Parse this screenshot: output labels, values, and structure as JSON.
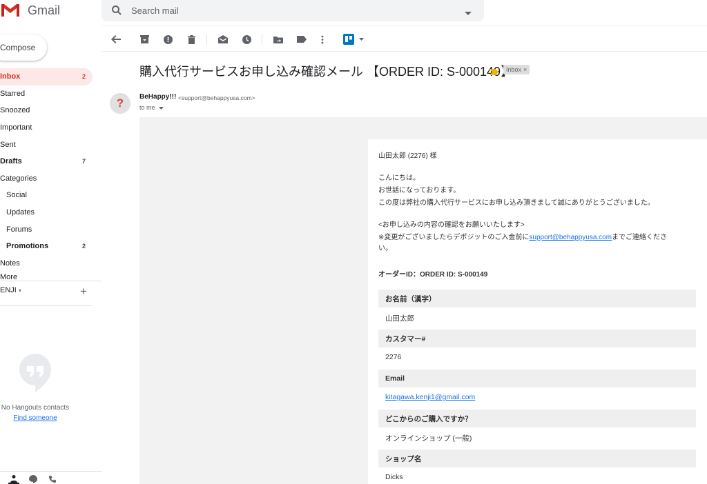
{
  "header": {
    "app_name": "Gmail",
    "search_placeholder": "Search mail"
  },
  "sidebar": {
    "compose_label": "Compose",
    "items": [
      {
        "label": "Inbox",
        "count": "2"
      },
      {
        "label": "Starred",
        "count": ""
      },
      {
        "label": "Snoozed",
        "count": ""
      },
      {
        "label": "Important",
        "count": ""
      },
      {
        "label": "Sent",
        "count": ""
      },
      {
        "label": "Drafts",
        "count": "7"
      },
      {
        "label": "Categories",
        "count": ""
      },
      {
        "label": "Social",
        "count": ""
      },
      {
        "label": "Updates",
        "count": ""
      },
      {
        "label": "Forums",
        "count": ""
      },
      {
        "label": "Promotions",
        "count": "2"
      },
      {
        "label": "Notes",
        "count": ""
      },
      {
        "label": "More",
        "count": ""
      }
    ],
    "user_label": "ENJI",
    "no_hangouts_text": "No Hangouts contacts",
    "find_someone_label": "Find someone"
  },
  "email": {
    "subject": "購入代行サービスお申し込み確認メール 【ORDER ID: S-000149】",
    "label_chip": "Inbox",
    "label_close": "×",
    "sender_name": "BeHappy!!!",
    "sender_email": "<support@behappyusa.com>",
    "recipient": "to me",
    "avatar_letter": "?",
    "greeting": "山田太郎 (2276) 様",
    "line1": "こんにちは。",
    "line2": "お世話になっております。",
    "line3": "この度は弊社の購入代行サービスにお申し込み頂きまして誠にありがとうございました。",
    "line4": "<お申し込みの内容の確認をお願いいたします>",
    "line5_pre": "※変更がございましたらデポジットのご入金前に",
    "line5_link": "support@behappyusa.com",
    "line5_post": "までご連絡くださ",
    "line6": "い。",
    "order_id": "オーダーID：ORDER ID: S-000149",
    "fields": [
      {
        "label": "お名前（漢字）",
        "value": "山田太郎"
      },
      {
        "label": "カスタマー#",
        "value": "2276"
      },
      {
        "label": "Email",
        "value": "kitagawa.kenji1@gmail.com"
      },
      {
        "label": "どこからのご購入ですか？",
        "value": "オンラインショップ (一般)"
      },
      {
        "label": "ショップ名",
        "value": "Dicks"
      }
    ]
  },
  "colors": {
    "accent_red": "#d93025",
    "link_blue": "#1a73e8",
    "label_yellow": "#f4b400"
  }
}
